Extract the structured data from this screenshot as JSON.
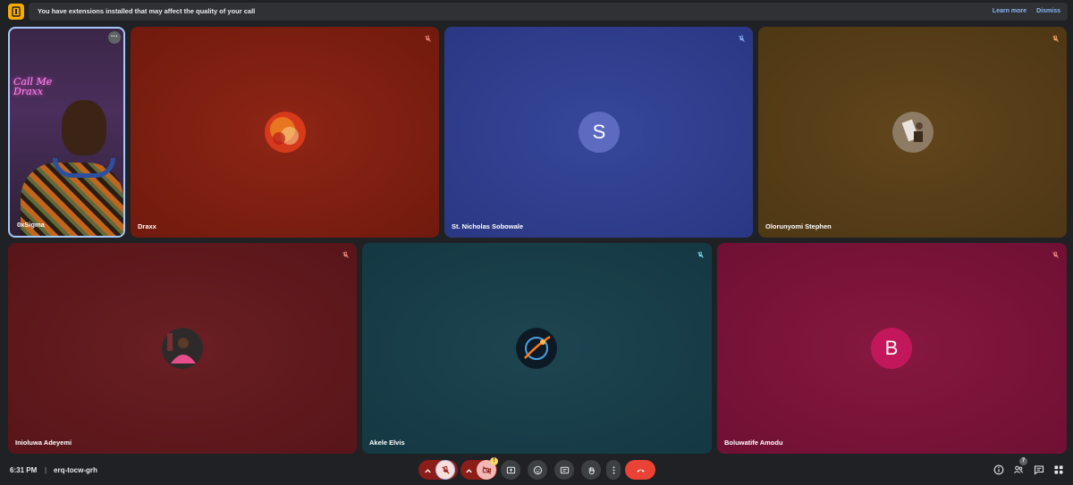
{
  "banner": {
    "message": "You have extensions installed that may affect the quality of your call",
    "learn_more": "Learn more",
    "dismiss": "Dismiss"
  },
  "tiles": [
    {
      "name": "0xSigma",
      "muted": false,
      "self": true
    },
    {
      "name": "Draxx",
      "muted": true
    },
    {
      "name": "St. Nicholas Sobowale",
      "muted": true,
      "initial": "S",
      "avatar_color": "#5c6bc0"
    },
    {
      "name": "Olorunyomi Stephen",
      "muted": true
    },
    {
      "name": "Inioluwa Adeyemi",
      "muted": true
    },
    {
      "name": "Akele Elvis",
      "muted": true
    },
    {
      "name": "Boluwatife Amodu",
      "muted": true,
      "initial": "B",
      "avatar_color": "#c2185b"
    }
  ],
  "self_video_neon": "Call Me Draxx",
  "bottom_bar": {
    "time": "6:31 PM",
    "separator": "|",
    "meeting_code": "erq-tocw-grh",
    "people_count": "7",
    "camera_warning": "!"
  },
  "colors": {
    "end_call": "#ea4335",
    "muted_red": "#8c1d18",
    "accent_blue": "#8ab4f8",
    "banner_icon": "#f9ab00"
  },
  "icons": [
    "extension-warning-icon",
    "mic-off-icon",
    "chevron-up-icon",
    "camera-off-icon",
    "present-icon",
    "emoji-icon",
    "captions-icon",
    "raise-hand-icon",
    "more-vert-icon",
    "call-end-icon",
    "info-icon",
    "people-icon",
    "chat-icon"
  ]
}
